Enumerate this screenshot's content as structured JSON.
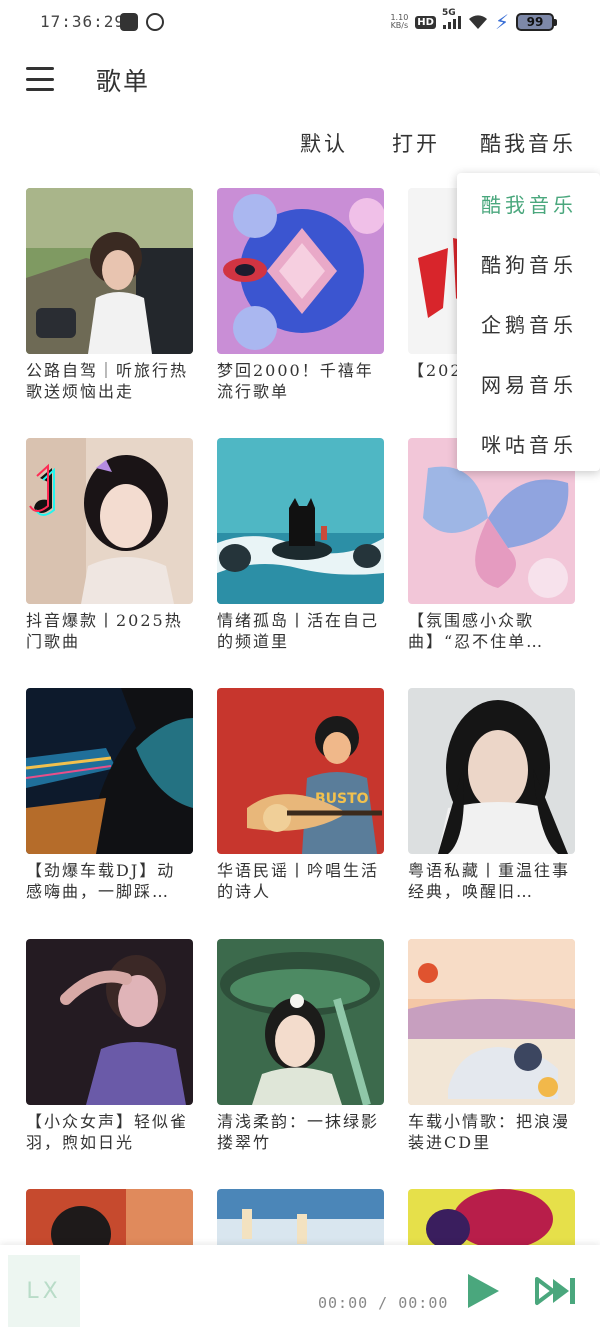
{
  "status_bar": {
    "time": "17:36:29",
    "net_speed_value": "1.10",
    "net_speed_unit": "KB/s",
    "hd": "HD",
    "network": "5G",
    "battery": "99"
  },
  "header": {
    "title": "歌单"
  },
  "tabs": {
    "default": "默认",
    "open": "打开",
    "source": "酷我音乐"
  },
  "dropdown": {
    "items": [
      "酷我音乐",
      "酷狗音乐",
      "企鹅音乐",
      "网易音乐",
      "咪咕音乐"
    ],
    "selected": "酷我音乐"
  },
  "playlists": [
    {
      "title": "公路自驾｜听旅行热歌送烦恼出走"
    },
    {
      "title": "梦回2000！千禧年流行歌单"
    },
    {
      "title": "【2025…一秒沦…"
    },
    {
      "title": "抖音爆款丨2025热门歌曲"
    },
    {
      "title": "情绪孤岛丨活在自己的频道里"
    },
    {
      "title": "【氛围感小众歌曲】“忍不住单…"
    },
    {
      "title": "【劲爆车载DJ】动感嗨曲，一脚踩…"
    },
    {
      "title": "华语民谣丨吟唱生活的诗人"
    },
    {
      "title": "粤语私藏丨重温往事经典，唤醒旧…"
    },
    {
      "title": "【小众女声】轻似雀羽，煦如日光"
    },
    {
      "title": "清浅柔韵：一抹绿影搂翠竹"
    },
    {
      "title": "车载小情歌：把浪漫装进CD里"
    }
  ],
  "player": {
    "cover_text": "LX",
    "time": "00:00 / 00:00"
  },
  "colors": {
    "accent": "#4aa77d",
    "text": "#333333"
  }
}
